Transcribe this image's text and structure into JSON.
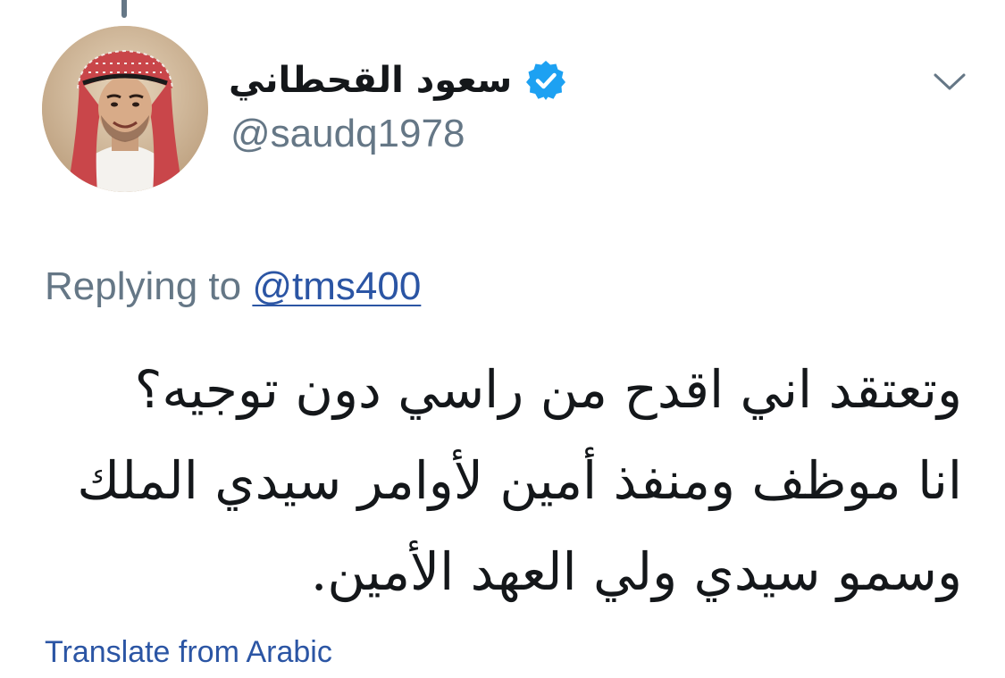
{
  "tweet": {
    "author": {
      "display_name": "سعود القحطاني",
      "handle": "@saudq1978",
      "verified": true,
      "verified_color": "#1da1f2"
    },
    "reply": {
      "prefix": "Replying to",
      "mention": "@tms400"
    },
    "text_lines": [
      "وتعتقد اني اقدح من راسي دون توجيه؟",
      "انا موظف ومنفذ أمين لأوامر سيدي الملك",
      "وسمو  سيدي ولي العهد الأمين."
    ],
    "translate_label": "Translate from Arabic",
    "icons": {
      "verified": "verified-badge-icon",
      "menu": "chevron-down-icon",
      "avatar": "profile-photo"
    },
    "colors": {
      "link": "#2b55a4",
      "secondary_text": "#657786",
      "primary_text": "#14171a"
    }
  }
}
